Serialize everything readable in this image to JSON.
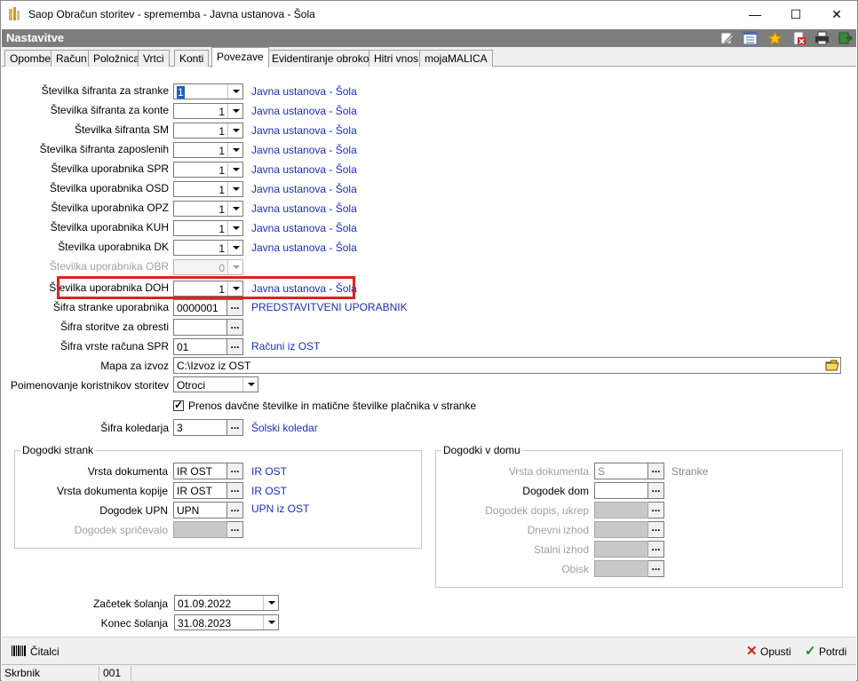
{
  "window": {
    "title": "Saop Obračun storitev - sprememba - Javna ustanova - Šola",
    "minimize": "—",
    "maximize": "☐",
    "close": "✕"
  },
  "header": {
    "title": "Nastavitve"
  },
  "tabs": [
    "Opombe",
    "Račun",
    "Položnica",
    "Vrtci",
    "Konti",
    "Povezave",
    "Evidentiranje obrokov",
    "Hitri vnos",
    "mojaMALICA"
  ],
  "active_tab": "Povezave",
  "settings": [
    {
      "label": "Številka šifranta za stranke",
      "value": "1",
      "desc": "Javna ustanova - Šola"
    },
    {
      "label": "Številka šifranta za konte",
      "value": "1",
      "desc": "Javna ustanova - Šola"
    },
    {
      "label": "Številka šifranta SM",
      "value": "1",
      "desc": "Javna ustanova - Šola"
    },
    {
      "label": "Številka šifranta zaposlenih",
      "value": "1",
      "desc": "Javna ustanova - Šola"
    },
    {
      "label": "Številka uporabnika SPR",
      "value": "1",
      "desc": "Javna ustanova - Šola"
    },
    {
      "label": "Številka uporabnika OSD",
      "value": "1",
      "desc": "Javna ustanova - Šola"
    },
    {
      "label": "Številka uporabnika OPZ",
      "value": "1",
      "desc": "Javna ustanova - Šola"
    },
    {
      "label": "Številka uporabnika KUH",
      "value": "1",
      "desc": "Javna ustanova - Šola"
    },
    {
      "label": "Številka uporabnika DK",
      "value": "1",
      "desc": "Javna ustanova - Šola"
    },
    {
      "label": "Številka uporabnika OBR",
      "value": "0",
      "desc": ""
    },
    {
      "label": "Številka uporabnika DOH",
      "value": "1",
      "desc": "Javna ustanova - Šola"
    }
  ],
  "lookups": [
    {
      "label": "Šifra stranke uporabnika",
      "value": "0000001",
      "desc": "PREDSTAVITVENI UPORABNIK"
    },
    {
      "label": "Šifra storitve za obresti",
      "value": "",
      "desc": ""
    },
    {
      "label": "Šifra vrste računa SPR",
      "value": "01",
      "desc": "Računi iz OST"
    }
  ],
  "export_folder": {
    "label": "Mapa za izvoz",
    "value": "C:\\Izvoz iz OST"
  },
  "naming": {
    "label": "Poimenovanje koristnikov storitev",
    "value": "Otroci"
  },
  "transfer_checkbox": {
    "label": "Prenos davčne številke in matične številke plačnika v stranke",
    "checked": true,
    "mark": "✓"
  },
  "calendar": {
    "label": "Šifra koledarja",
    "value": "3",
    "desc": "Šolski koledar"
  },
  "events_clients": {
    "title": "Dogodki strank",
    "rows": [
      {
        "label": "Vrsta dokumenta",
        "value": "IR OST",
        "desc": "IR OST"
      },
      {
        "label": "Vrsta dokumenta kopije",
        "value": "IR OST",
        "desc": "IR OST"
      },
      {
        "label": "Dogodek UPN",
        "value": "UPN",
        "desc": "UPN iz OST"
      },
      {
        "label": "Dogodek spričevalo",
        "value": "",
        "desc": ""
      }
    ]
  },
  "events_home": {
    "title": "Dogodki v domu",
    "rows": [
      {
        "label": "Vrsta dokumenta",
        "value": "S",
        "desc": "Stranke"
      },
      {
        "label": "Dogodek dom",
        "value": "",
        "desc": ""
      },
      {
        "label": "Dogodek dopis, ukrep",
        "value": "",
        "desc": ""
      },
      {
        "label": "Dnevni izhod",
        "value": "",
        "desc": ""
      },
      {
        "label": "Stalni izhod",
        "value": "",
        "desc": ""
      },
      {
        "label": "Obisk",
        "value": "",
        "desc": ""
      }
    ]
  },
  "school_year": {
    "start_label": "Začetek šolanja",
    "start_value": "01.09.2022",
    "end_label": "Konec šolanja",
    "end_value": "31.08.2023"
  },
  "buttons": {
    "readers": "Čitalci",
    "cancel": "Opusti",
    "confirm": "Potrdi",
    "dots": "..."
  },
  "status": {
    "user": "Skrbnik",
    "code": "001"
  },
  "colors": {
    "highlight": "#e02020",
    "link": "#1a2fb8",
    "header": "#7d7d7d"
  }
}
